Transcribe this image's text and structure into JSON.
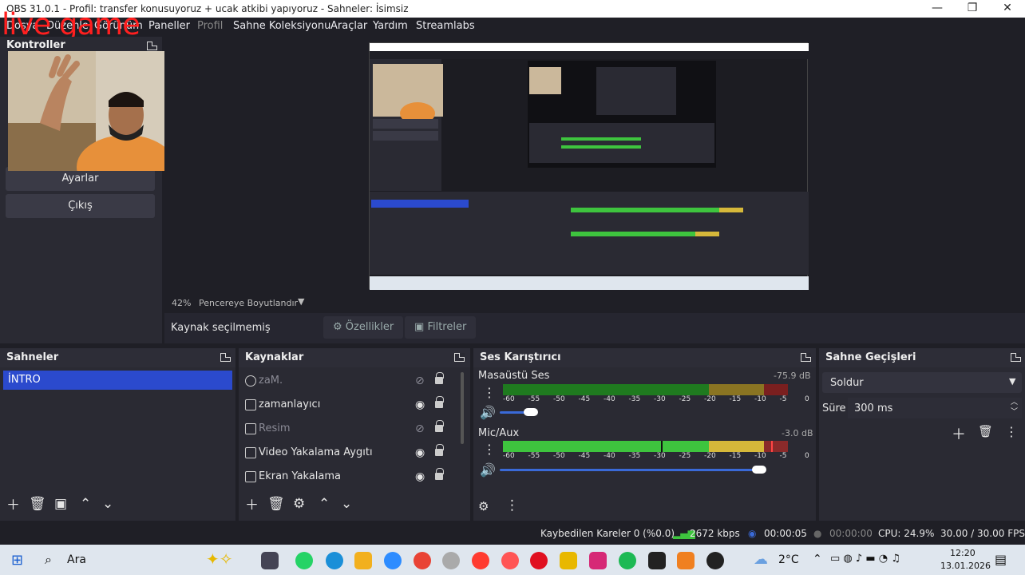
{
  "window": {
    "title": "OBS 31.0.1 - Profil: transfer  konusuyoruz + ucak atkibi yapıyoruz - Sahneler: İsimsiz",
    "minimize": "—",
    "maximize": "❐",
    "close": "✕"
  },
  "overlay_text": "live game",
  "menu": [
    "Dosya",
    "Düzenle",
    "Görünüm",
    "Paneller",
    "Profil",
    "Sahne Koleksiyonu",
    "Araçlar",
    "Yardım",
    "Streamlabs"
  ],
  "controls": {
    "title": "Kontroller",
    "settings_label": "Ayarlar",
    "exit_label": "Çıkış"
  },
  "preview": {
    "zoom": "42%",
    "fit_label": "Pencereye Boyutlandır"
  },
  "source_toolbar": {
    "no_source": "Kaynak seçilmemiş",
    "properties": "Özellikler",
    "filters": "Filtreler"
  },
  "scenes": {
    "title": "Sahneler",
    "items": [
      "İNTRO"
    ]
  },
  "sources": {
    "title": "Kaynaklar",
    "items": [
      {
        "label": "zaM.",
        "visible": false
      },
      {
        "label": "zamanlayıcı",
        "visible": true
      },
      {
        "label": "Resim",
        "visible": false
      },
      {
        "label": "Video Yakalama Aygıtı",
        "visible": true
      },
      {
        "label": "Ekran Yakalama",
        "visible": true
      }
    ]
  },
  "mixer": {
    "title": "Ses Karıştırıcı",
    "channels": [
      {
        "name": "Masaüstü Ses",
        "db": "-75.9 dB",
        "level": 1.0,
        "volume": 0.2
      },
      {
        "name": "Mic/Aux",
        "db": "-3.0 dB",
        "level": 0.9,
        "volume": 0.95
      }
    ],
    "scale": [
      "-60",
      "-55",
      "-50",
      "-45",
      "-40",
      "-35",
      "-30",
      "-25",
      "-20",
      "-15",
      "-10",
      "-5",
      "0"
    ]
  },
  "transitions": {
    "title": "Sahne Geçişleri",
    "selected": "Soldur",
    "duration_label": "Süre",
    "duration_value": "300 ms"
  },
  "status": {
    "dropped": "Kaybedilen Kareler 0 (%0.0)",
    "bitrate": "2672 kbps",
    "stream_time": "00:00:05",
    "rec_time": "00:00:00",
    "cpu": "CPU: 24.9%",
    "fps": "30.00 / 30.00 FPS"
  },
  "taskbar": {
    "search": "Ara",
    "weather": "2°C",
    "time": "12:20",
    "date": "13.01.2026"
  },
  "colors": {
    "accent": "#2b4acd",
    "meter_green": "#3ec43e",
    "meter_yellow": "#d6b83a",
    "meter_red": "#c23333"
  }
}
